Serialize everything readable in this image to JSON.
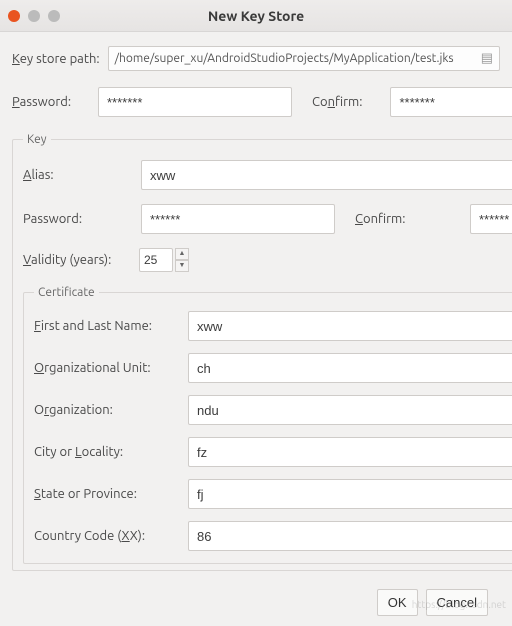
{
  "window": {
    "title": "New Key Store"
  },
  "fields": {
    "keyStorePath": {
      "value": "/home/super_xu/AndroidStudioProjects/MyApplication/test.jks"
    },
    "password": {
      "label": "Password:",
      "value": "*******"
    },
    "confirm": {
      "label": "Confirm:",
      "value": "*******"
    }
  },
  "key": {
    "legend": "Key",
    "alias": {
      "label": "Alias:",
      "value": "xww"
    },
    "password": {
      "label": "Password:",
      "value": "******"
    },
    "confirm": {
      "label": "Confirm:",
      "value": "******"
    },
    "validity": {
      "value": "25"
    }
  },
  "cert": {
    "legend": "Certificate",
    "firstLast": {
      "value": "xww"
    },
    "orgUnit": {
      "value": "ch"
    },
    "org": {
      "value": "ndu"
    },
    "city": {
      "label": "City or Locality:",
      "value": "fz"
    },
    "state": {
      "value": "fj"
    },
    "country": {
      "value": "86"
    }
  },
  "buttons": {
    "ok": "OK",
    "cancel": "Cancel"
  },
  "watermark": "https://blog.csdn.net"
}
